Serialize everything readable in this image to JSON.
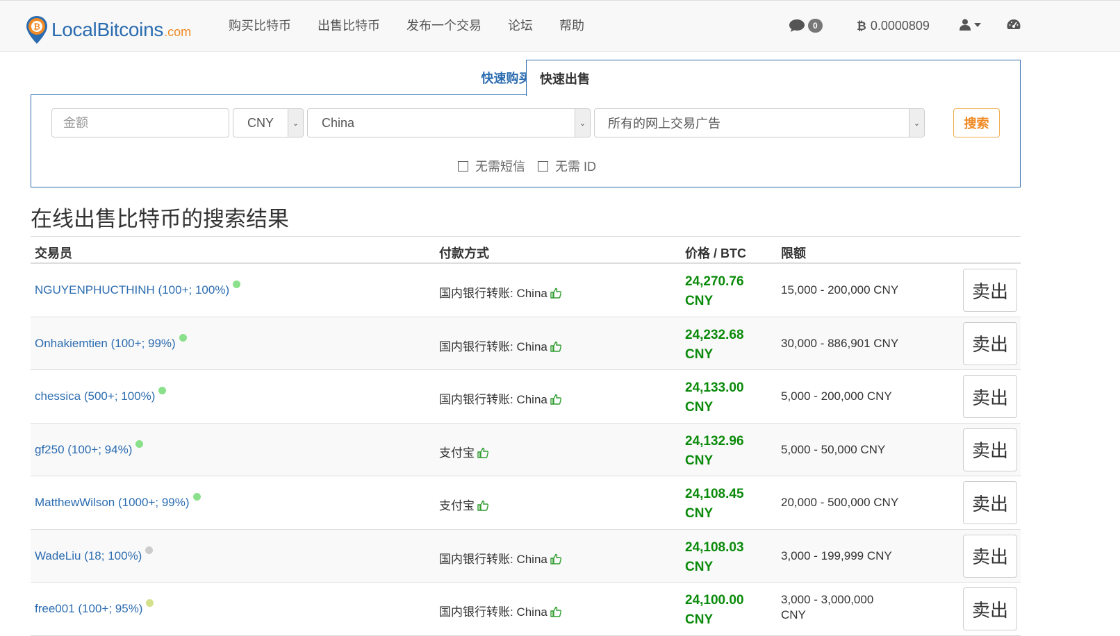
{
  "brand": {
    "name": "LocalBitcoins",
    "suffix": ".com"
  },
  "nav": {
    "links": [
      "购买比特币",
      "出售比特币",
      "发布一个交易",
      "论坛",
      "帮助"
    ],
    "message_count": "0",
    "balance": "0.0000809"
  },
  "tabs": {
    "buy": "快速购买",
    "sell": "快速出售"
  },
  "search": {
    "amount_placeholder": "金额",
    "currency": "CNY",
    "country": "China",
    "method": "所有的网上交易广告",
    "button": "搜索",
    "check_no_sms": "无需短信",
    "check_no_id": "无需 ID"
  },
  "results": {
    "title": "在线出售比特币的搜索结果",
    "headers": {
      "trader": "交易员",
      "payment": "付款方式",
      "price": "价格 / BTC",
      "limit": "限额"
    },
    "sell_label": "卖出",
    "rows": [
      {
        "trader": "NGUYENPHUCTHINH (100+; 100%)",
        "status_color": "#8be08b",
        "payment": "国内银行转账: China",
        "price": "24,270.76",
        "currency": "CNY",
        "limit": "15,000 - 200,000 CNY"
      },
      {
        "trader": "Onhakiemtien (100+; 99%)",
        "status_color": "#8be08b",
        "payment": "国内银行转账: China",
        "price": "24,232.68",
        "currency": "CNY",
        "limit": "30,000 - 886,901 CNY"
      },
      {
        "trader": "chessica (500+; 100%)",
        "status_color": "#8be08b",
        "payment": "国内银行转账: China",
        "price": "24,133.00",
        "currency": "CNY",
        "limit": "5,000 - 200,000 CNY"
      },
      {
        "trader": "gf250 (100+; 94%)",
        "status_color": "#8be08b",
        "payment": "支付宝",
        "price": "24,132.96",
        "currency": "CNY",
        "limit": "5,000 - 50,000 CNY"
      },
      {
        "trader": "MatthewWilson (1000+; 99%)",
        "status_color": "#8be08b",
        "payment": "支付宝",
        "price": "24,108.45",
        "currency": "CNY",
        "limit": "20,000 - 500,000 CNY"
      },
      {
        "trader": "WadeLiu (18; 100%)",
        "status_color": "#cccccc",
        "payment": "国内银行转账: China",
        "price": "24,108.03",
        "currency": "CNY",
        "limit": "3,000 - 199,999 CNY"
      },
      {
        "trader": "free001 (100+; 95%)",
        "status_color": "#d4e08a",
        "payment": "国内银行转账: China",
        "price": "24,100.00",
        "currency": "CNY",
        "limit": "3,000 - 3,000,000 CNY"
      }
    ]
  }
}
